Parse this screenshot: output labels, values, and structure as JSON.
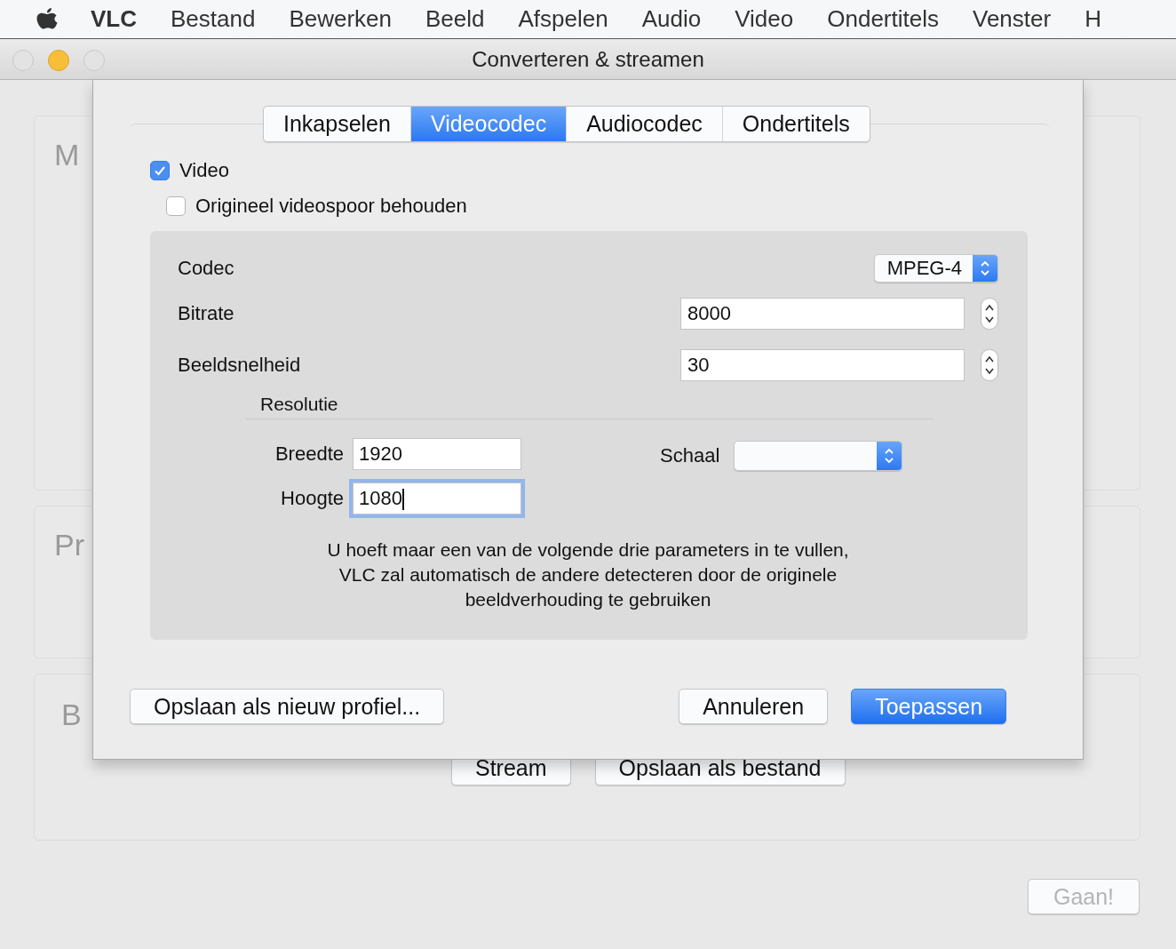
{
  "menu_bar": {
    "items": [
      {
        "label": "VLC",
        "kind": "app"
      },
      {
        "label": "Bestand",
        "kind": "menu"
      },
      {
        "label": "Bewerken",
        "kind": "menu"
      },
      {
        "label": "Beeld",
        "kind": "menu"
      },
      {
        "label": "Afspelen",
        "kind": "menu"
      },
      {
        "label": "Audio",
        "kind": "menu"
      },
      {
        "label": "Video",
        "kind": "menu"
      },
      {
        "label": "Ondertitels",
        "kind": "menu"
      },
      {
        "label": "Venster",
        "kind": "menu"
      },
      {
        "label": "H",
        "kind": "menu"
      }
    ]
  },
  "window": {
    "title": "Converteren & streamen"
  },
  "background": {
    "groups": [
      {
        "label": "M"
      },
      {
        "label": "Pr"
      },
      {
        "label": "B"
      }
    ],
    "buttons": [
      "Stream",
      "Opslaan als bestand"
    ],
    "go_button": {
      "label": "Gaan!",
      "disabled": true
    }
  },
  "sheet": {
    "tabs": [
      {
        "label": "Inkapselen",
        "selected": false
      },
      {
        "label": "Videocodec",
        "selected": true
      },
      {
        "label": "Audiocodec",
        "selected": false
      },
      {
        "label": "Ondertitels",
        "selected": false
      }
    ],
    "video": {
      "label": "Video",
      "checked": true
    },
    "keep_original": {
      "label": "Origineel videospoor behouden",
      "checked": false
    },
    "codec": {
      "label": "Codec",
      "value": "MPEG-4"
    },
    "bitrate": {
      "label": "Bitrate",
      "value": "8000"
    },
    "framerate": {
      "label": "Beeldsnelheid",
      "value": "30"
    },
    "resolution": {
      "title": "Resolutie",
      "width": {
        "label": "Breedte",
        "value": "1920",
        "focused": false
      },
      "height": {
        "label": "Hoogte",
        "value": "1080",
        "focused": true
      },
      "scale": {
        "label": "Schaal"
      }
    },
    "note": "U hoeft maar een van de volgende drie parameters in te vullen,\nVLC zal automatisch de andere detecteren door de originele\nbeeldverhouding te gebruiken",
    "buttons": [
      {
        "label": "Opslaan als nieuw profiel...",
        "default": false
      },
      {
        "label": "Annuleren",
        "default": false
      },
      {
        "label": "Toepassen",
        "default": true
      }
    ]
  }
}
